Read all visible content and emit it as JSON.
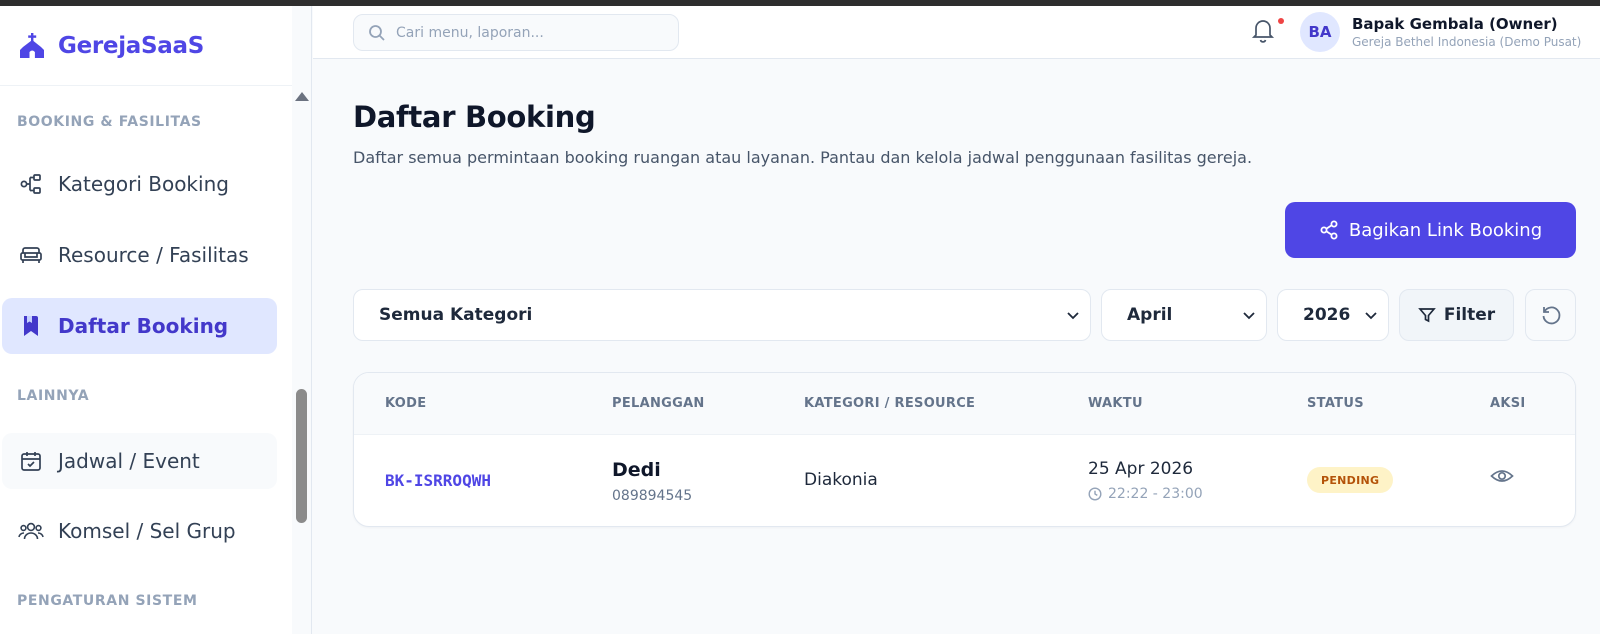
{
  "brand": {
    "name": "GerejaSaaS"
  },
  "sidebar": {
    "sections": [
      "BOOKING & FASILITAS",
      "LAINNYA",
      "PENGATURAN SISTEM"
    ],
    "items": [
      {
        "label": "Kategori Booking",
        "icon": "nodes-icon"
      },
      {
        "label": "Resource / Fasilitas",
        "icon": "sofa-icon"
      },
      {
        "label": "Daftar Booking",
        "icon": "bookmark-icon",
        "active": true
      },
      {
        "label": "Jadwal / Event",
        "icon": "calendar-check-icon"
      },
      {
        "label": "Komsel / Sel Grup",
        "icon": "users-icon"
      }
    ]
  },
  "header": {
    "search_placeholder": "Cari menu, laporan...",
    "user": {
      "initials": "BA",
      "name": "Bapak Gembala (Owner)",
      "org": "Gereja Bethel Indonesia (Demo Pusat)"
    }
  },
  "main": {
    "title": "Daftar Booking",
    "description": "Daftar semua permintaan booking ruangan atau layanan. Pantau dan kelola jadwal penggunaan fasilitas gereja.",
    "share_button": "Bagikan Link Booking",
    "filters": {
      "category": "Semua Kategori",
      "month": "April",
      "year": "2026",
      "filter_button": "Filter"
    },
    "table": {
      "columns": [
        "KODE",
        "PELANGGAN",
        "KATEGORI / RESOURCE",
        "WAKTU",
        "STATUS",
        "AKSI"
      ],
      "rows": [
        {
          "code": "BK-ISRROQWH",
          "customer": "Dedi",
          "phone": "089894545",
          "category": "Diakonia",
          "date": "25 Apr 2026",
          "time": "22:22 - 23:00",
          "status": "PENDING"
        }
      ]
    }
  },
  "colors": {
    "accent": "#4f46e5",
    "active_bg": "#e0e7ff",
    "pending_bg": "#fef3c7",
    "pending_text": "#b45309"
  }
}
